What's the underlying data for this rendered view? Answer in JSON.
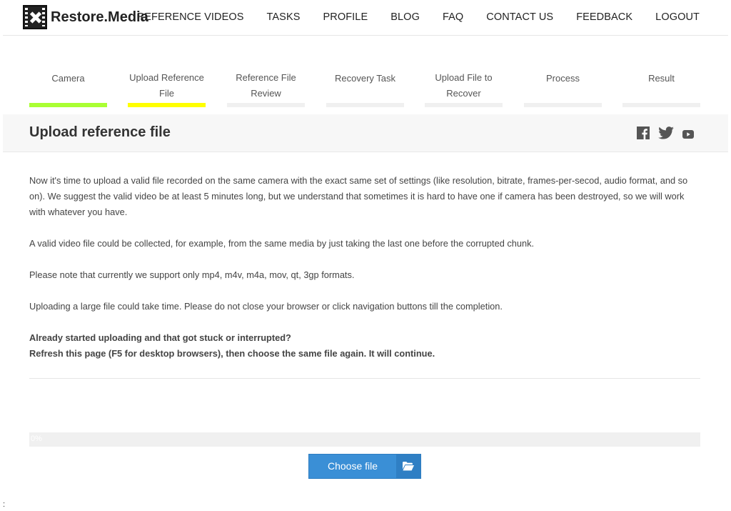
{
  "header": {
    "brand": "Restore.Media",
    "nav": [
      {
        "label": "REFERENCE VIDEOS"
      },
      {
        "label": "TASKS"
      },
      {
        "label": "PROFILE"
      },
      {
        "label": "BLOG"
      },
      {
        "label": "FAQ"
      },
      {
        "label": "CONTACT US"
      },
      {
        "label": "FEEDBACK"
      },
      {
        "label": "LOGOUT"
      }
    ]
  },
  "steps": [
    {
      "label": "Camera",
      "status": "done",
      "color": "#aaff33"
    },
    {
      "label": "Upload Reference File",
      "status": "current",
      "color": "#ffff00"
    },
    {
      "label": "Reference File Review",
      "status": "pending",
      "color": "#f0f0f0"
    },
    {
      "label": "Recovery Task",
      "status": "pending",
      "color": "#f0f0f0"
    },
    {
      "label": "Upload File to Recover",
      "status": "pending",
      "color": "#f0f0f0"
    },
    {
      "label": "Process",
      "status": "pending",
      "color": "#f0f0f0"
    },
    {
      "label": "Result",
      "status": "pending",
      "color": "#f0f0f0"
    }
  ],
  "page": {
    "title": "Upload reference file",
    "social_icons": [
      "facebook-icon",
      "twitter-icon",
      "youtube-icon"
    ]
  },
  "content": {
    "p1": "Now it's time to upload a valid file recorded on the same camera with the exact same set of settings (like resolution, bitrate, frames-per-secod, audio format, and so on). We suggest the valid video be at least 5 minutes long, but we understand that sometimes it is hard to have one if camera has been destroyed, so we will work with whatever you have.",
    "p2": "A valid video file could be collected, for example, from the same media by just taking the last one before the corrupted chunk.",
    "p3": "Please note that currently we support only mp4, m4v, m4a, mov, qt, 3gp formats.",
    "p4": "Uploading a large file could take time. Please do not close your browser or click navigation buttons till the completion.",
    "bold1": "Already started uploading and that got stuck or interrupted?",
    "bold2": "Refresh this page (F5 for desktop browsers), then choose the same file again. It will continue."
  },
  "upload": {
    "progress_text": "0%",
    "progress_value": 0,
    "button_label": "Choose file",
    "button_icon": "folder-open-icon",
    "accent": "#3a8fd6"
  },
  "stray_text": ":"
}
